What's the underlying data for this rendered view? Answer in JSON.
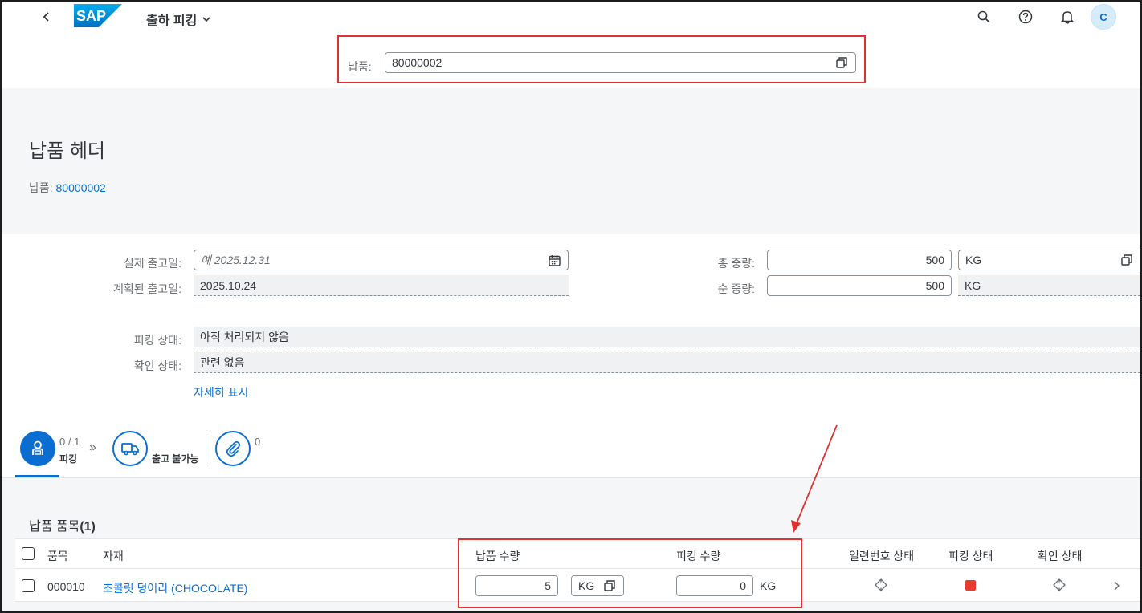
{
  "shell": {
    "app_title": "출하 피킹",
    "avatar_initial": "C",
    "icons": {
      "back": "chevron-left-icon",
      "title_menu": "chevron-down-icon",
      "search": "search-icon",
      "help": "help-icon",
      "notifications": "bell-icon"
    }
  },
  "filter": {
    "delivery_label": "납품:",
    "delivery_value": "80000002"
  },
  "object_header": {
    "title": "납품 헤더",
    "sub_label": "납품:",
    "sub_value": "80000002"
  },
  "form": {
    "actual_gi_date_label": "실제 출고일:",
    "actual_gi_date_placeholder": "예 2025.12.31",
    "planned_gi_date_label": "계획된 출고일:",
    "planned_gi_date_value": "2025.10.24",
    "total_weight_label": "총 중량:",
    "total_weight_value": "500",
    "total_weight_unit": "KG",
    "net_weight_label": "순 중량:",
    "net_weight_value": "500",
    "net_weight_unit": "KG",
    "picking_status_label": "피킹 상태:",
    "picking_status_value": "아직 처리되지 않음",
    "confirm_status_label": "확인 상태:",
    "confirm_status_value": "관련 없음",
    "show_more": "자세히 표시"
  },
  "process_flow": {
    "picking_count": "0 / 1",
    "picking_label": "피킹",
    "gi_label": "출고 불가능",
    "attachments_count": "0"
  },
  "items_table": {
    "title": "납품 품목",
    "count": "(1)",
    "columns": {
      "item": "품목",
      "material": "자재",
      "delivery_qty": "납품 수량",
      "picking_qty": "피킹 수량",
      "serial_status": "일련번호 상태",
      "picking_status": "피킹 상태",
      "confirm_status": "확인 상태"
    },
    "rows": [
      {
        "item": "000010",
        "material": "초콜릿 덩어리 (CHOCOLATE)",
        "delivery_qty": "5",
        "delivery_unit": "KG",
        "picking_qty": "0",
        "picking_unit": "KG"
      }
    ]
  },
  "colors": {
    "accent": "#0a6ed1",
    "status_red": "#e93c2c",
    "annotation_red": "#e03030"
  }
}
